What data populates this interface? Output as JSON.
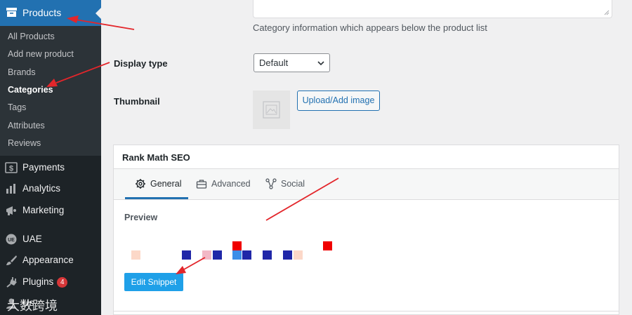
{
  "sidebar": {
    "active_menu": {
      "label": "Products",
      "icon": "archive-icon"
    },
    "submenu": [
      {
        "label": "All Products",
        "current": false
      },
      {
        "label": "Add new product",
        "current": false
      },
      {
        "label": "Brands",
        "current": false
      },
      {
        "label": "Categories",
        "current": true
      },
      {
        "label": "Tags",
        "current": false
      },
      {
        "label": "Attributes",
        "current": false
      },
      {
        "label": "Reviews",
        "current": false
      }
    ],
    "menu": [
      {
        "label": "Payments",
        "icon": "dollar-icon"
      },
      {
        "label": "Analytics",
        "icon": "bar-chart-icon"
      },
      {
        "label": "Marketing",
        "icon": "megaphone-icon"
      },
      {
        "label": "UAE",
        "icon": "uae-logo-icon"
      },
      {
        "label": "Appearance",
        "icon": "paintbrush-icon"
      },
      {
        "label": "Plugins",
        "icon": "plug-icon",
        "badge": "4"
      },
      {
        "label": "Us",
        "icon": "users-icon"
      }
    ]
  },
  "form": {
    "description_help": "Category information which appears below the product list",
    "display_type": {
      "label": "Display type",
      "value": "Default"
    },
    "thumbnail": {
      "label": "Thumbnail",
      "button_label": "Upload/Add image"
    }
  },
  "rank_math": {
    "title": "Rank Math SEO",
    "tabs": [
      {
        "label": "General",
        "icon": "gear-icon",
        "active": true
      },
      {
        "label": "Advanced",
        "icon": "toolbox-icon",
        "active": false
      },
      {
        "label": "Social",
        "icon": "share-icon",
        "active": false
      }
    ],
    "preview_label": "Preview",
    "edit_snippet_label": "Edit Snippet"
  },
  "watermark": "大数跨境",
  "colors": {
    "admin_bar": "#1d2327",
    "submenu_bg": "#2c3338",
    "accent": "#2271b1",
    "badge": "#d63638",
    "edit_button": "#1fa0e8",
    "annotation_arrow": "#e3262b"
  }
}
